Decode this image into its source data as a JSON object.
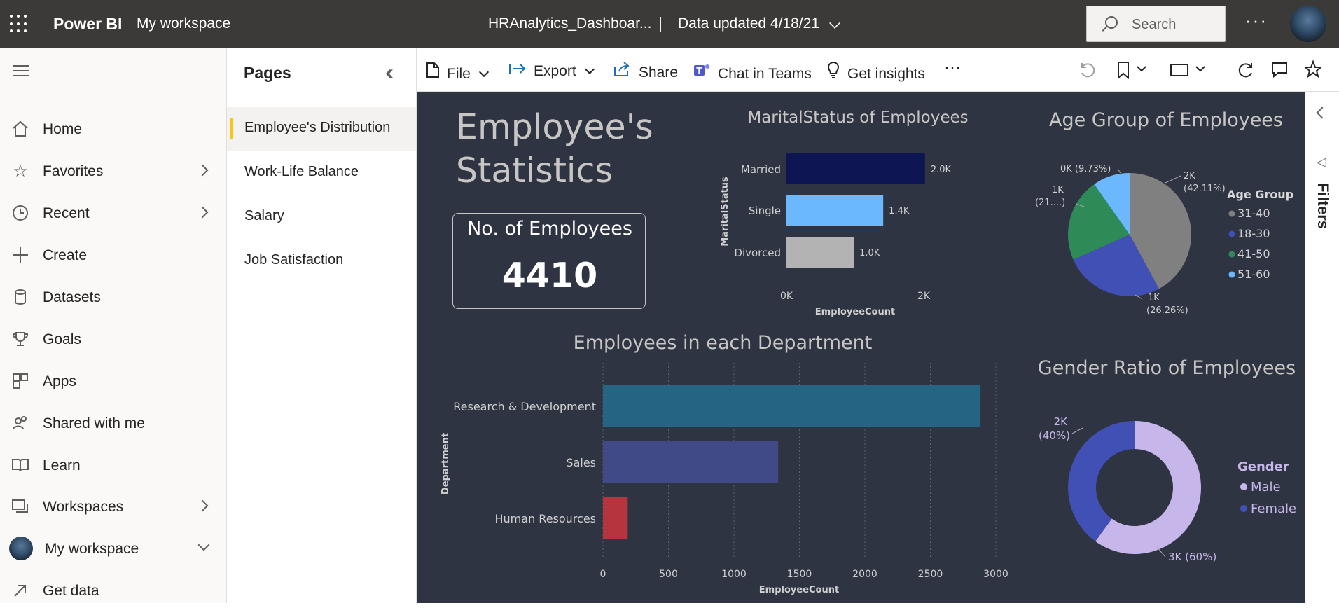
{
  "topbar": {
    "brand": "Power BI",
    "workspace": "My workspace",
    "report_title": "HRAnalytics_Dashboar...",
    "separator": "|",
    "data_updated": "Data updated 4/18/21",
    "search_placeholder": "Search",
    "more": "···"
  },
  "nav": {
    "items": [
      {
        "label": "Home",
        "icon": "home-icon"
      },
      {
        "label": "Favorites",
        "icon": "star-icon"
      },
      {
        "label": "Recent",
        "icon": "clock-icon"
      },
      {
        "label": "Create",
        "icon": "plus-icon"
      },
      {
        "label": "Datasets",
        "icon": "database-icon"
      },
      {
        "label": "Goals",
        "icon": "trophy-icon"
      },
      {
        "label": "Apps",
        "icon": "apps-icon"
      },
      {
        "label": "Shared with me",
        "icon": "people-icon"
      },
      {
        "label": "Learn",
        "icon": "book-icon"
      }
    ],
    "bottom": [
      {
        "label": "Workspaces",
        "icon": "workspaces-icon"
      },
      {
        "label": "My workspace",
        "icon": "avatar"
      },
      {
        "label": "Get data",
        "icon": "arrow-up-right-icon"
      }
    ]
  },
  "pages": {
    "header": "Pages",
    "items": [
      "Employee's Distribution",
      "Work-Life Balance",
      "Salary",
      "Job Satisfaction"
    ],
    "active_index": 0
  },
  "toolbar": {
    "file": "File",
    "export": "Export",
    "share": "Share",
    "chat": "Chat in Teams",
    "insights": "Get insights",
    "more": "···"
  },
  "filters": {
    "label": "Filters"
  },
  "report": {
    "title": "Employee's Statistics",
    "card_label": "No. of Employees",
    "card_value": "4410"
  },
  "colors": {
    "canvas": "#2e3441",
    "active_page_marker": "#f2c811"
  },
  "chart_data": [
    {
      "type": "bar",
      "orientation": "horizontal",
      "title": "MaritalStatus of Employees",
      "xlabel": "EmployeeCount",
      "ylabel": "MaritalStatus",
      "categories": [
        "Married",
        "Single",
        "Divorced"
      ],
      "values": [
        2019,
        1410,
        981
      ],
      "data_labels": [
        "2.0K",
        "1.4K",
        "1.0K"
      ],
      "colors": [
        "#0d1652",
        "#6cb8ff",
        "#b3b3b3"
      ],
      "xticks": [
        "0K",
        "2K"
      ],
      "xlim": [
        0,
        2000
      ]
    },
    {
      "type": "pie",
      "title": "Age Group of Employees",
      "legend_title": "Age Group",
      "legend_position": "right",
      "slices": [
        {
          "name": "31-40",
          "value": 42.11,
          "label": "2K (42.11%)",
          "color": "#808080"
        },
        {
          "name": "18-30",
          "value": 26.26,
          "label": "1K (26.26%)",
          "color": "#4050b5"
        },
        {
          "name": "41-50",
          "value": 21.9,
          "label": "1K (21....)",
          "color": "#2e8b57"
        },
        {
          "name": "51-60",
          "value": 9.73,
          "label": "0K (9.73%)",
          "color": "#6cb8ff"
        }
      ]
    },
    {
      "type": "bar",
      "orientation": "horizontal",
      "title": "Employees in each Department",
      "xlabel": "EmployeeCount",
      "ylabel": "Department",
      "categories": [
        "Research & Development",
        "Sales",
        "Human Resources"
      ],
      "values": [
        2883,
        1338,
        189
      ],
      "colors": [
        "#256482",
        "#3f4a87",
        "#b5343e"
      ],
      "xticks": [
        0,
        500,
        1000,
        1500,
        2000,
        2500,
        3000
      ],
      "xlim": [
        0,
        3000
      ],
      "grid": "vertical dotted"
    },
    {
      "type": "pie",
      "subtype": "donut",
      "title": "Gender Ratio of Employees",
      "legend_title": "Gender",
      "legend_position": "right",
      "slices": [
        {
          "name": "Male",
          "value": 60,
          "label": "3K (60%)",
          "color": "#c7b6ea"
        },
        {
          "name": "Female",
          "value": 40,
          "label": "2K (40%)",
          "color": "#4050b5"
        }
      ]
    }
  ]
}
